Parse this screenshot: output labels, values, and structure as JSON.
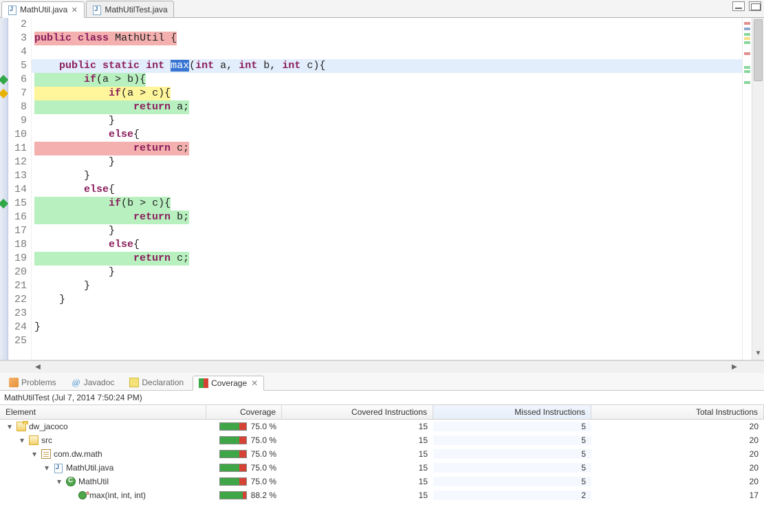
{
  "tabs": [
    {
      "label": "MathUtil.java",
      "active": true
    },
    {
      "label": "MathUtilTest.java",
      "active": false
    }
  ],
  "editor": {
    "lines": [
      {
        "n": 2,
        "hl": "",
        "marker": "",
        "tokens": []
      },
      {
        "n": 3,
        "hl": "inline-red",
        "marker": "",
        "tokens": [
          [
            "kw",
            "public"
          ],
          [
            "sp",
            " "
          ],
          [
            "kw",
            "class"
          ],
          [
            "sp",
            " "
          ],
          [
            "name",
            "MathUtil"
          ],
          [
            "sp",
            " "
          ],
          [
            "punc",
            "{"
          ]
        ]
      },
      {
        "n": 4,
        "hl": "",
        "marker": "",
        "tokens": []
      },
      {
        "n": 5,
        "hl": "blue",
        "marker": "",
        "tokens": [
          [
            "sp",
            "    "
          ],
          [
            "kw",
            "public"
          ],
          [
            "sp",
            " "
          ],
          [
            "kw",
            "static"
          ],
          [
            "sp",
            " "
          ],
          [
            "type",
            "int"
          ],
          [
            "sp",
            " "
          ],
          [
            "sel",
            "max"
          ],
          [
            "punc",
            "("
          ],
          [
            "type",
            "int"
          ],
          [
            "sp",
            " "
          ],
          [
            "name",
            "a"
          ],
          [
            "punc",
            ","
          ],
          [
            "sp",
            " "
          ],
          [
            "type",
            "int"
          ],
          [
            "sp",
            " "
          ],
          [
            "name",
            "b"
          ],
          [
            "punc",
            ","
          ],
          [
            "sp",
            " "
          ],
          [
            "type",
            "int"
          ],
          [
            "sp",
            " "
          ],
          [
            "name",
            "c"
          ],
          [
            "punc",
            "){"
          ]
        ]
      },
      {
        "n": 6,
        "hl": "green",
        "marker": "green",
        "tokens": [
          [
            "sp",
            "        "
          ],
          [
            "kw",
            "if"
          ],
          [
            "punc",
            "("
          ],
          [
            "name",
            "a"
          ],
          [
            "sp",
            " "
          ],
          [
            "punc",
            ">"
          ],
          [
            "sp",
            " "
          ],
          [
            "name",
            "b"
          ],
          [
            "punc",
            "){"
          ]
        ]
      },
      {
        "n": 7,
        "hl": "yellow",
        "marker": "yellow",
        "tokens": [
          [
            "sp",
            "            "
          ],
          [
            "kw",
            "if"
          ],
          [
            "punc",
            "("
          ],
          [
            "name",
            "a"
          ],
          [
            "sp",
            " "
          ],
          [
            "punc",
            ">"
          ],
          [
            "sp",
            " "
          ],
          [
            "name",
            "c"
          ],
          [
            "punc",
            "){"
          ]
        ]
      },
      {
        "n": 8,
        "hl": "green",
        "marker": "",
        "tokens": [
          [
            "sp",
            "                "
          ],
          [
            "kw",
            "return"
          ],
          [
            "sp",
            " "
          ],
          [
            "name",
            "a"
          ],
          [
            "punc",
            ";"
          ]
        ]
      },
      {
        "n": 9,
        "hl": "",
        "marker": "",
        "tokens": [
          [
            "sp",
            "            "
          ],
          [
            "punc",
            "}"
          ]
        ]
      },
      {
        "n": 10,
        "hl": "",
        "marker": "",
        "tokens": [
          [
            "sp",
            "            "
          ],
          [
            "kw",
            "else"
          ],
          [
            "punc",
            "{"
          ]
        ]
      },
      {
        "n": 11,
        "hl": "red",
        "marker": "",
        "tokens": [
          [
            "sp",
            "                "
          ],
          [
            "kw",
            "return"
          ],
          [
            "sp",
            " "
          ],
          [
            "name",
            "c"
          ],
          [
            "punc",
            ";"
          ]
        ]
      },
      {
        "n": 12,
        "hl": "",
        "marker": "",
        "tokens": [
          [
            "sp",
            "            "
          ],
          [
            "punc",
            "}"
          ]
        ]
      },
      {
        "n": 13,
        "hl": "",
        "marker": "",
        "tokens": [
          [
            "sp",
            "        "
          ],
          [
            "punc",
            "}"
          ]
        ]
      },
      {
        "n": 14,
        "hl": "",
        "marker": "",
        "tokens": [
          [
            "sp",
            "        "
          ],
          [
            "kw",
            "else"
          ],
          [
            "punc",
            "{"
          ]
        ]
      },
      {
        "n": 15,
        "hl": "green",
        "marker": "green",
        "tokens": [
          [
            "sp",
            "            "
          ],
          [
            "kw",
            "if"
          ],
          [
            "punc",
            "("
          ],
          [
            "name",
            "b"
          ],
          [
            "sp",
            " "
          ],
          [
            "punc",
            ">"
          ],
          [
            "sp",
            " "
          ],
          [
            "name",
            "c"
          ],
          [
            "punc",
            "){"
          ]
        ]
      },
      {
        "n": 16,
        "hl": "green",
        "marker": "",
        "tokens": [
          [
            "sp",
            "                "
          ],
          [
            "kw",
            "return"
          ],
          [
            "sp",
            " "
          ],
          [
            "name",
            "b"
          ],
          [
            "punc",
            ";"
          ]
        ]
      },
      {
        "n": 17,
        "hl": "",
        "marker": "",
        "tokens": [
          [
            "sp",
            "            "
          ],
          [
            "punc",
            "}"
          ]
        ]
      },
      {
        "n": 18,
        "hl": "",
        "marker": "",
        "tokens": [
          [
            "sp",
            "            "
          ],
          [
            "kw",
            "else"
          ],
          [
            "punc",
            "{"
          ]
        ]
      },
      {
        "n": 19,
        "hl": "green",
        "marker": "",
        "tokens": [
          [
            "sp",
            "                "
          ],
          [
            "kw",
            "return"
          ],
          [
            "sp",
            " "
          ],
          [
            "name",
            "c"
          ],
          [
            "punc",
            ";"
          ]
        ]
      },
      {
        "n": 20,
        "hl": "",
        "marker": "",
        "tokens": [
          [
            "sp",
            "            "
          ],
          [
            "punc",
            "}"
          ]
        ]
      },
      {
        "n": 21,
        "hl": "",
        "marker": "",
        "tokens": [
          [
            "sp",
            "        "
          ],
          [
            "punc",
            "}"
          ]
        ]
      },
      {
        "n": 22,
        "hl": "",
        "marker": "",
        "tokens": [
          [
            "sp",
            "    "
          ],
          [
            "punc",
            "}"
          ]
        ]
      },
      {
        "n": 23,
        "hl": "",
        "marker": "",
        "tokens": []
      },
      {
        "n": 24,
        "hl": "",
        "marker": "",
        "tokens": [
          [
            "punc",
            "}"
          ]
        ]
      },
      {
        "n": 25,
        "hl": "",
        "marker": "",
        "tokens": []
      }
    ]
  },
  "views": {
    "tabs": [
      {
        "label": "Problems",
        "icon": "problems",
        "active": false
      },
      {
        "label": "Javadoc",
        "icon": "javadoc",
        "active": false
      },
      {
        "label": "Declaration",
        "icon": "declaration",
        "active": false
      },
      {
        "label": "Coverage",
        "icon": "coverage",
        "active": true
      }
    ]
  },
  "coverage": {
    "title": "MathUtilTest (Jul 7, 2014 7:50:24 PM)",
    "columns": {
      "element": "Element",
      "coverage": "Coverage",
      "covered": "Covered Instructions",
      "missed": "Missed Instructions",
      "total": "Total Instructions"
    },
    "rows": [
      {
        "indent": 0,
        "twisty": "▾",
        "icon": "proj",
        "label": "dw_jacoco",
        "cov": "75.0 %",
        "covbar": 0.75,
        "ci": "15",
        "mi": "5",
        "ti": "20"
      },
      {
        "indent": 1,
        "twisty": "▾",
        "icon": "src",
        "label": "src",
        "cov": "75.0 %",
        "covbar": 0.75,
        "ci": "15",
        "mi": "5",
        "ti": "20"
      },
      {
        "indent": 2,
        "twisty": "▾",
        "icon": "pkg",
        "label": "com.dw.math",
        "cov": "75.0 %",
        "covbar": 0.75,
        "ci": "15",
        "mi": "5",
        "ti": "20"
      },
      {
        "indent": 3,
        "twisty": "▾",
        "icon": "java",
        "label": "MathUtil.java",
        "cov": "75.0 %",
        "covbar": 0.75,
        "ci": "15",
        "mi": "5",
        "ti": "20"
      },
      {
        "indent": 4,
        "twisty": "▾",
        "icon": "class",
        "label": "MathUtil",
        "cov": "75.0 %",
        "covbar": 0.75,
        "ci": "15",
        "mi": "5",
        "ti": "20"
      },
      {
        "indent": 5,
        "twisty": "",
        "icon": "method",
        "label": "max(int, int, int)",
        "cov": "88.2 %",
        "covbar": 0.882,
        "ci": "15",
        "mi": "2",
        "ti": "17"
      }
    ]
  }
}
